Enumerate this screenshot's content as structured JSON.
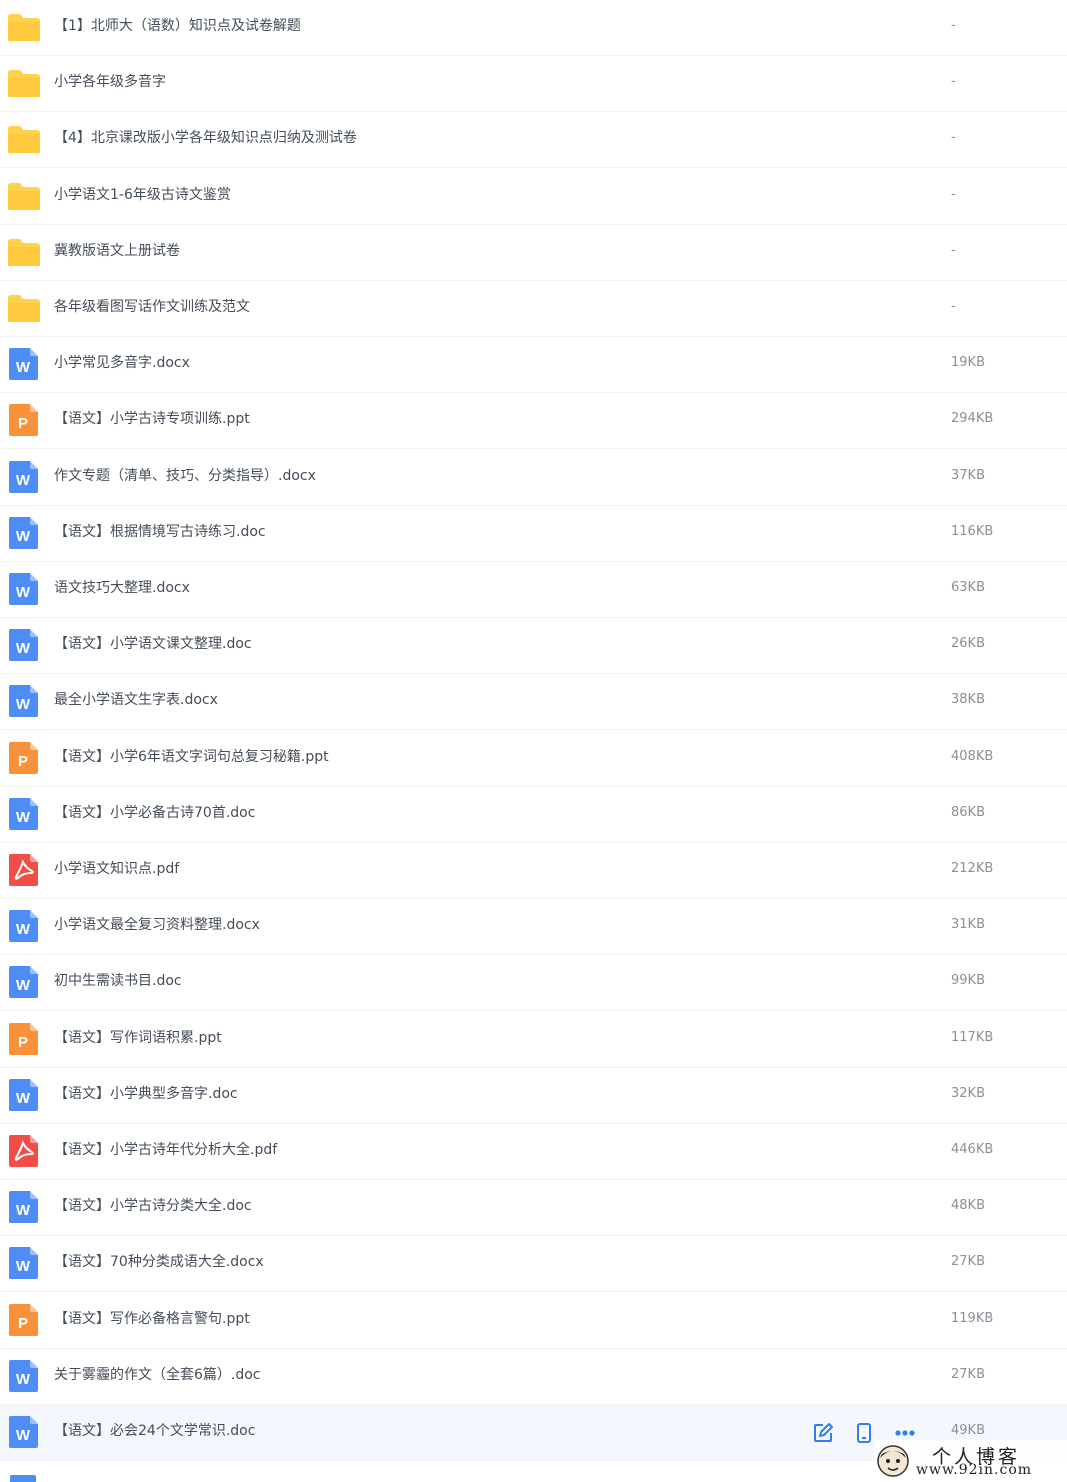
{
  "files": [
    {
      "type": "folder",
      "name": "【1】北师大（语数）知识点及试卷解题",
      "size": "-"
    },
    {
      "type": "folder",
      "name": "小学各年级多音字",
      "size": "-"
    },
    {
      "type": "folder",
      "name": "【4】北京课改版小学各年级知识点归纳及测试卷",
      "size": "-"
    },
    {
      "type": "folder",
      "name": "小学语文1-6年级古诗文鉴赏",
      "size": "-"
    },
    {
      "type": "folder",
      "name": "冀教版语文上册试卷",
      "size": "-"
    },
    {
      "type": "folder",
      "name": "各年级看图写话作文训练及范文",
      "size": "-"
    },
    {
      "type": "word",
      "name": "小学常见多音字.docx",
      "size": "19KB"
    },
    {
      "type": "ppt",
      "name": "【语文】小学古诗专项训练.ppt",
      "size": "294KB"
    },
    {
      "type": "word",
      "name": "作文专题（清单、技巧、分类指导）.docx",
      "size": "37KB"
    },
    {
      "type": "word",
      "name": "【语文】根据情境写古诗练习.doc",
      "size": "116KB"
    },
    {
      "type": "word",
      "name": "语文技巧大整理.docx",
      "size": "63KB"
    },
    {
      "type": "word",
      "name": "【语文】小学语文课文整理.doc",
      "size": "26KB"
    },
    {
      "type": "word",
      "name": "最全小学语文生字表.docx",
      "size": "38KB"
    },
    {
      "type": "ppt",
      "name": "【语文】小学6年语文字词句总复习秘籍.ppt",
      "size": "408KB"
    },
    {
      "type": "word",
      "name": "【语文】小学必备古诗70首.doc",
      "size": "86KB"
    },
    {
      "type": "pdf",
      "name": "小学语文知识点.pdf",
      "size": "212KB"
    },
    {
      "type": "word",
      "name": "小学语文最全复习资料整理.docx",
      "size": "31KB"
    },
    {
      "type": "word",
      "name": "初中生需读书目.doc",
      "size": "99KB"
    },
    {
      "type": "ppt",
      "name": "【语文】写作词语积累.ppt",
      "size": "117KB"
    },
    {
      "type": "word",
      "name": "【语文】小学典型多音字.doc",
      "size": "32KB"
    },
    {
      "type": "pdf",
      "name": "【语文】小学古诗年代分析大全.pdf",
      "size": "446KB"
    },
    {
      "type": "word",
      "name": "【语文】小学古诗分类大全.doc",
      "size": "48KB"
    },
    {
      "type": "word",
      "name": "【语文】70种分类成语大全.docx",
      "size": "27KB"
    },
    {
      "type": "ppt",
      "name": "【语文】写作必备格言警句.ppt",
      "size": "119KB"
    },
    {
      "type": "word",
      "name": "关于雾霾的作文（全套6篇）.doc",
      "size": "27KB"
    },
    {
      "type": "word",
      "name": "【语文】必会24个文学常识.doc",
      "size": "49KB",
      "hovered": true
    }
  ],
  "row_actions": [
    "edit-icon",
    "phone-icon",
    "more-icon"
  ],
  "icon_glyphs": {
    "word": "W",
    "ppt": "P"
  },
  "colors": {
    "folder": "#ffd24c",
    "word": "#4d8df5",
    "ppt": "#f7913a",
    "pdf": "#f24e48",
    "action": "#2f7ff0"
  },
  "watermark": {
    "title": "个人博客",
    "url": "www.92in.com"
  }
}
